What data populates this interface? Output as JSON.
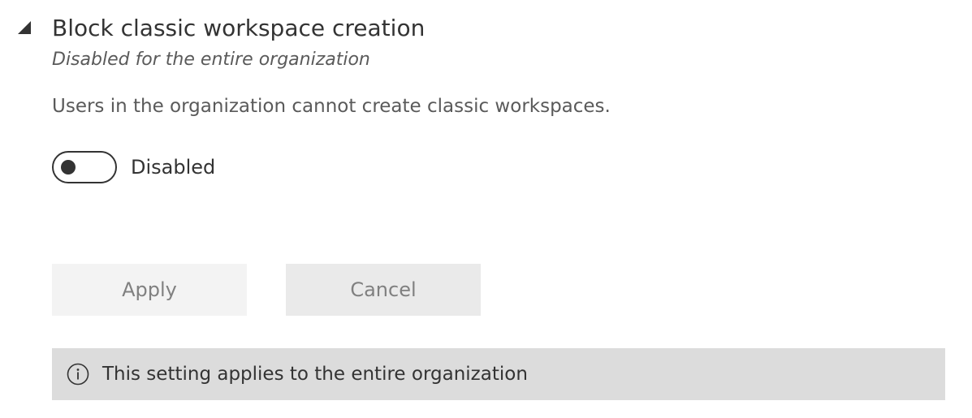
{
  "setting": {
    "title": "Block classic workspace creation",
    "subtitle": "Disabled for the entire organization",
    "description": "Users in the organization cannot create classic workspaces.",
    "expanded": true,
    "collapse_icon": "triangle-expanded-icon"
  },
  "toggle": {
    "state": "off",
    "label": "Disabled"
  },
  "buttons": {
    "apply_label": "Apply",
    "cancel_label": "Cancel"
  },
  "info": {
    "icon": "info-icon",
    "text": "This setting applies to the entire organization"
  },
  "colors": {
    "text": "#333333",
    "muted_text": "#5a5a5a",
    "button_text_disabled": "#808080",
    "apply_bg": "#f3f3f3",
    "cancel_bg": "#eaeaea",
    "info_bg": "#dcdcdc"
  }
}
